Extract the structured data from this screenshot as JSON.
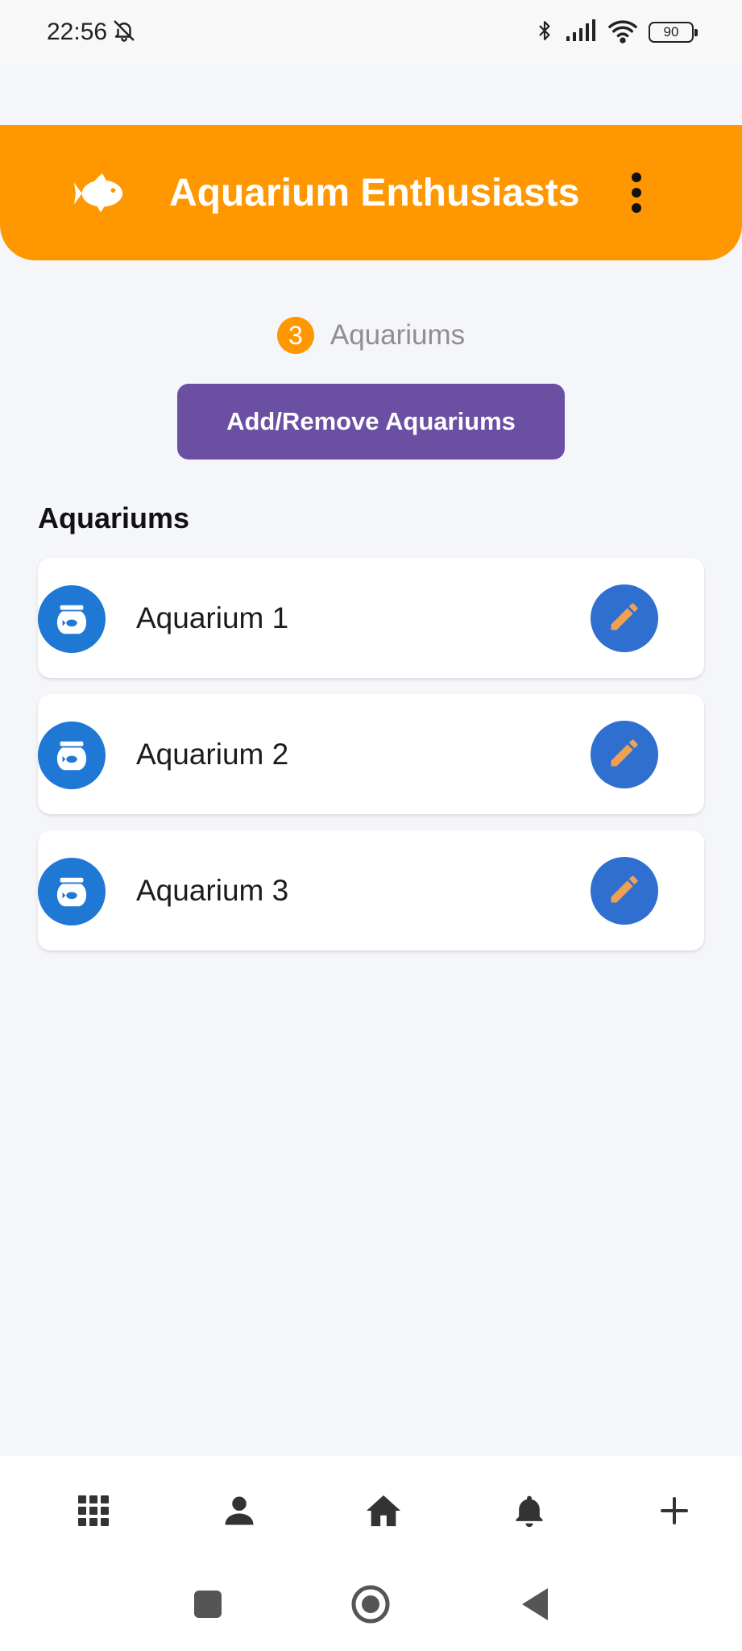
{
  "status_bar": {
    "time": "22:56",
    "battery": "90",
    "icons": [
      "bell-off-icon",
      "bluetooth-icon",
      "signal-icon",
      "wifi-icon",
      "battery-icon"
    ]
  },
  "header": {
    "title": "Aquarium Enthusiasts",
    "logo_icon": "fish-icon",
    "menu_icon": "more-vertical-icon"
  },
  "summary": {
    "count": "3",
    "label": "Aquariums"
  },
  "actions": {
    "add_remove_label": "Add/Remove Aquariums"
  },
  "section": {
    "title": "Aquariums"
  },
  "aquariums": [
    {
      "name": "Aquarium 1",
      "icon": "fishbowl-icon",
      "action_icon": "pencil-icon"
    },
    {
      "name": "Aquarium 2",
      "icon": "fishbowl-icon",
      "action_icon": "pencil-icon"
    },
    {
      "name": "Aquarium 3",
      "icon": "fishbowl-icon",
      "action_icon": "pencil-icon"
    }
  ],
  "bottom_nav": {
    "items": [
      "grid-icon",
      "person-icon",
      "home-icon",
      "bell-icon",
      "plus-icon"
    ]
  },
  "colors": {
    "header": "#ff9800",
    "primary_button": "#6a4fa3",
    "icon_circle": "#1e78d4",
    "edit_circle": "#2f6fd0",
    "pencil": "#f0a050",
    "background": "#f5f6fa"
  }
}
